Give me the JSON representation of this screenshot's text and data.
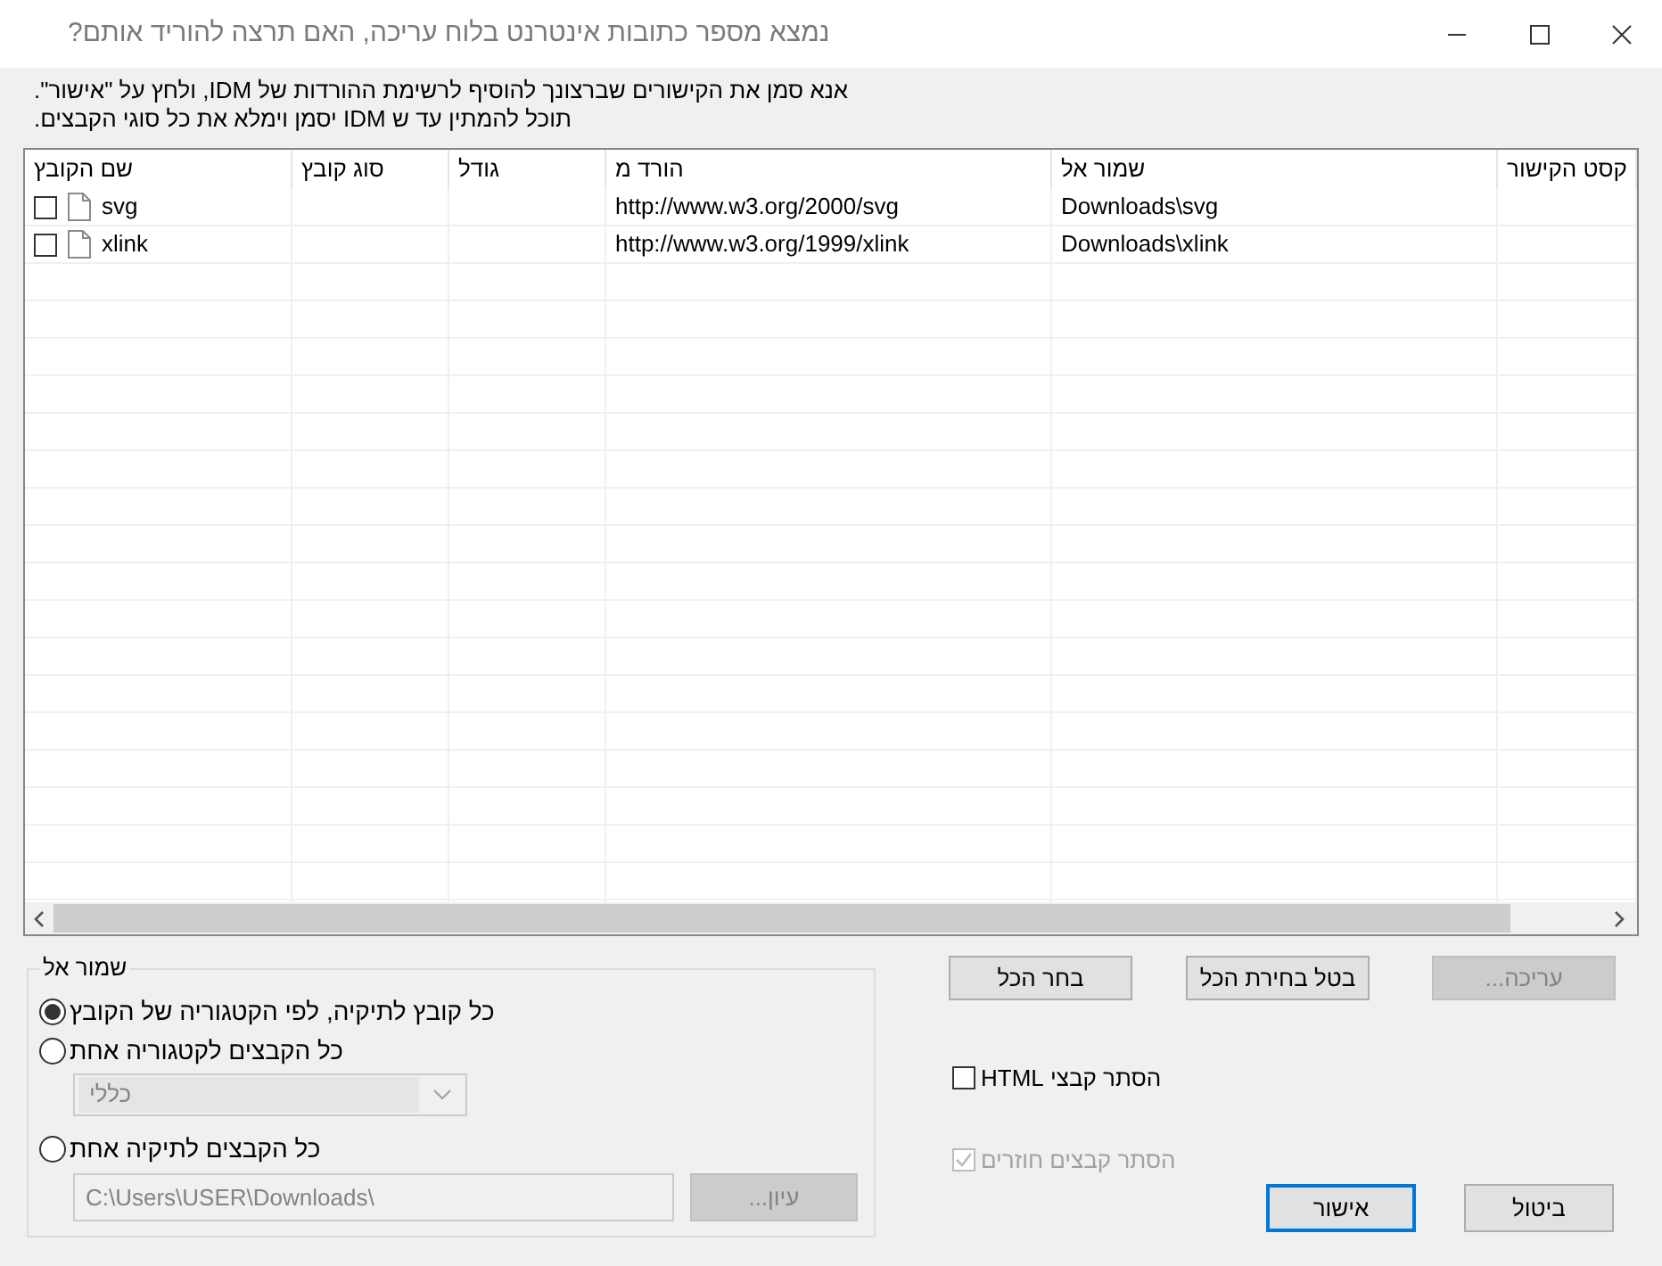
{
  "window": {
    "title": "נמצא מספר כתובות אינטרנט בלוח עריכה, האם תרצה להוריד אותם?"
  },
  "instructions": [
    "אנא סמן את הקישורים שברצונך להוסיף לרשימת ההורדות של IDM, ולחץ על \"אישור\".",
    "תוכל להמתין עד ש IDM יסמן וימלא את כל סוגי הקבצים."
  ],
  "table": {
    "columns": [
      "קסט הקישור",
      "שמור אל",
      "הורד מ",
      "גודל",
      "סוג קובץ",
      "שם הקובץ"
    ],
    "rows": [
      {
        "checked": false,
        "file_name": "svg",
        "download_from": "http://www.w3.org/2000/svg",
        "save_to": "Downloads\\svg"
      },
      {
        "checked": false,
        "file_name": "xlink",
        "download_from": "http://www.w3.org/1999/xlink",
        "save_to": "Downloads\\xlink"
      }
    ]
  },
  "save_to": {
    "title": "שמור אל",
    "options": [
      {
        "label": "כל קובץ לתיקיה, לפי הקטגוריה של הקובץ",
        "selected": true
      },
      {
        "label": "כל הקבצים לקטגוריה אחת",
        "selected": false
      },
      {
        "label": "כל הקבצים לתיקיה אחת",
        "selected": false
      }
    ],
    "category": {
      "value": "כללי",
      "disabled": true
    },
    "folder": {
      "value": "C:\\Users\\USER\\Downloads\\",
      "disabled": true
    },
    "browse": {
      "label": "עיון...",
      "disabled": true
    }
  },
  "actions": [
    {
      "label": "עריכה...",
      "disabled": true
    },
    {
      "label": "בטל בחירת הכל",
      "disabled": false
    },
    {
      "label": "בחר הכל",
      "disabled": false
    }
  ],
  "options": [
    {
      "label": "הסתר קבצי HTML",
      "checked": false,
      "disabled": false
    },
    {
      "label": "הסתר קבצים חוזרים",
      "checked": true,
      "disabled": true
    }
  ],
  "buttons": [
    {
      "label": "ביטול",
      "default": false
    },
    {
      "label": "אישור",
      "default": true
    }
  ]
}
